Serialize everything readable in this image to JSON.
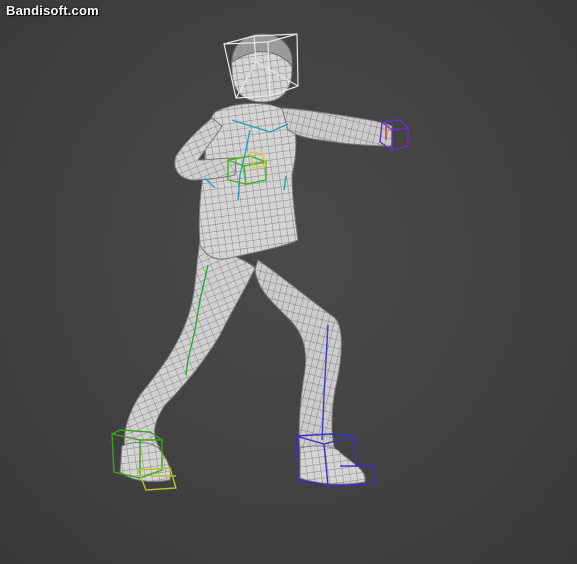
{
  "watermark": {
    "text": "Bandisoft.com"
  },
  "viewport": {
    "background_color": "#424242",
    "mesh_fill_color": "#cfcfcf",
    "wire_color": "#6e6e6e"
  },
  "controls": {
    "head": {
      "color": "#e6e6e6",
      "icon": "cube-wireframe-icon"
    },
    "left_hand": {
      "color": "#6a2fc9"
    },
    "right_hand": {
      "color": "#44b020"
    },
    "hand_accent": {
      "color": "#e0c430"
    },
    "left_foot": {
      "color": "#3f2fbf"
    },
    "right_foot": {
      "color": "#3fa01f"
    },
    "right_toe": {
      "color": "#b6c22a"
    },
    "spine": {
      "color": "#2aa0b8"
    },
    "left_leg_bone": {
      "color": "#3a3ad0"
    },
    "right_leg_bone": {
      "color": "#32a832"
    }
  }
}
